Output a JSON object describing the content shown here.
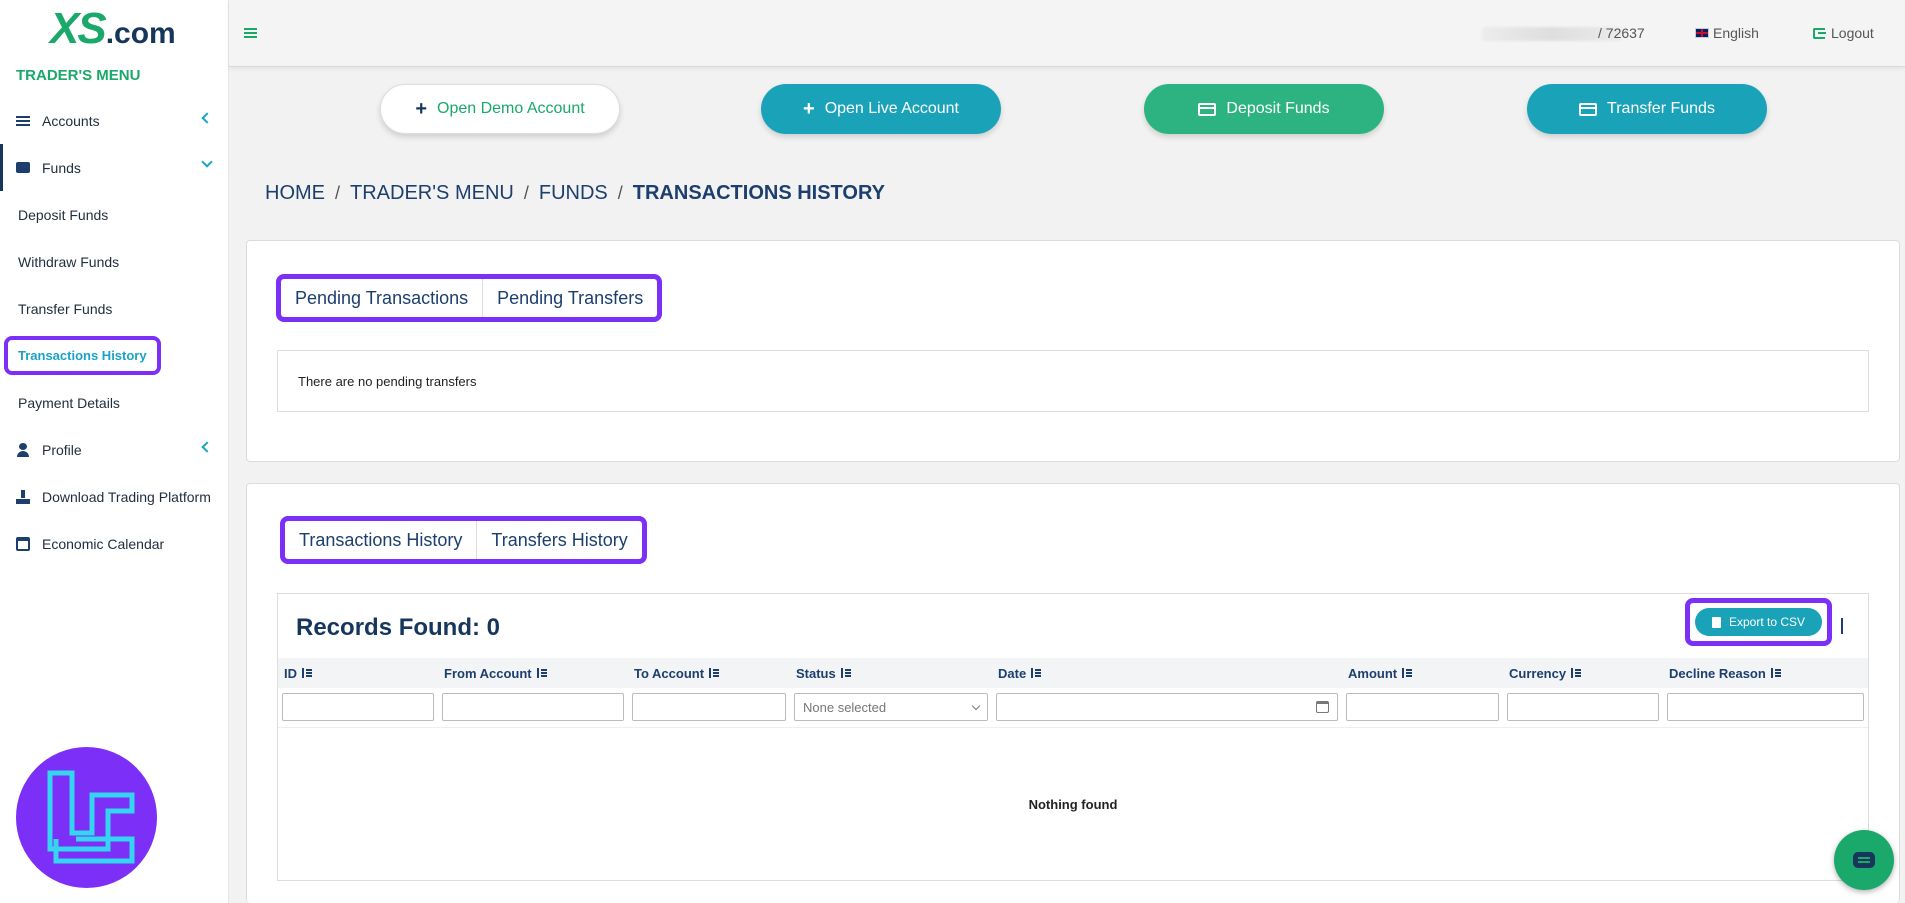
{
  "brand": {
    "logo_main": "XS",
    "logo_suffix": ".com"
  },
  "sidebar": {
    "title": "TRADER'S MENU",
    "accounts": "Accounts",
    "funds": "Funds",
    "funds_sub": [
      "Deposit Funds",
      "Withdraw Funds",
      "Transfer Funds",
      "Transactions History",
      "Payment Details"
    ],
    "profile": "Profile",
    "download": "Download Trading Platform",
    "calendar": "Economic Calendar"
  },
  "header": {
    "account_number": "/ 72637",
    "language": "English",
    "logout": "Logout"
  },
  "actions": {
    "demo": "Open Demo Account",
    "live": "Open Live Account",
    "deposit": "Deposit Funds",
    "transfer": "Transfer Funds"
  },
  "breadcrumb": {
    "home": "HOME",
    "menu": "TRADER'S MENU",
    "funds": "FUNDS",
    "current": "TRANSACTIONS HISTORY",
    "sep": "/"
  },
  "pending": {
    "tabs": [
      "Pending Transactions",
      "Pending Transfers"
    ],
    "empty_message": "There are no pending transfers"
  },
  "history": {
    "tabs": [
      "Transactions History",
      "Transfers History"
    ],
    "records_label": "Records Found: 0",
    "export_label": "Export to CSV",
    "columns": [
      "ID",
      "From Account",
      "To Account",
      "Status",
      "Date",
      "Amount",
      "Currency",
      "Decline Reason"
    ],
    "status_placeholder": "None selected",
    "empty_message": "Nothing found"
  },
  "colors": {
    "brand_green": "#1aa86b",
    "brand_navy": "#16365c",
    "teal": "#1aa3b8",
    "highlight_purple": "#7b2ff7"
  }
}
